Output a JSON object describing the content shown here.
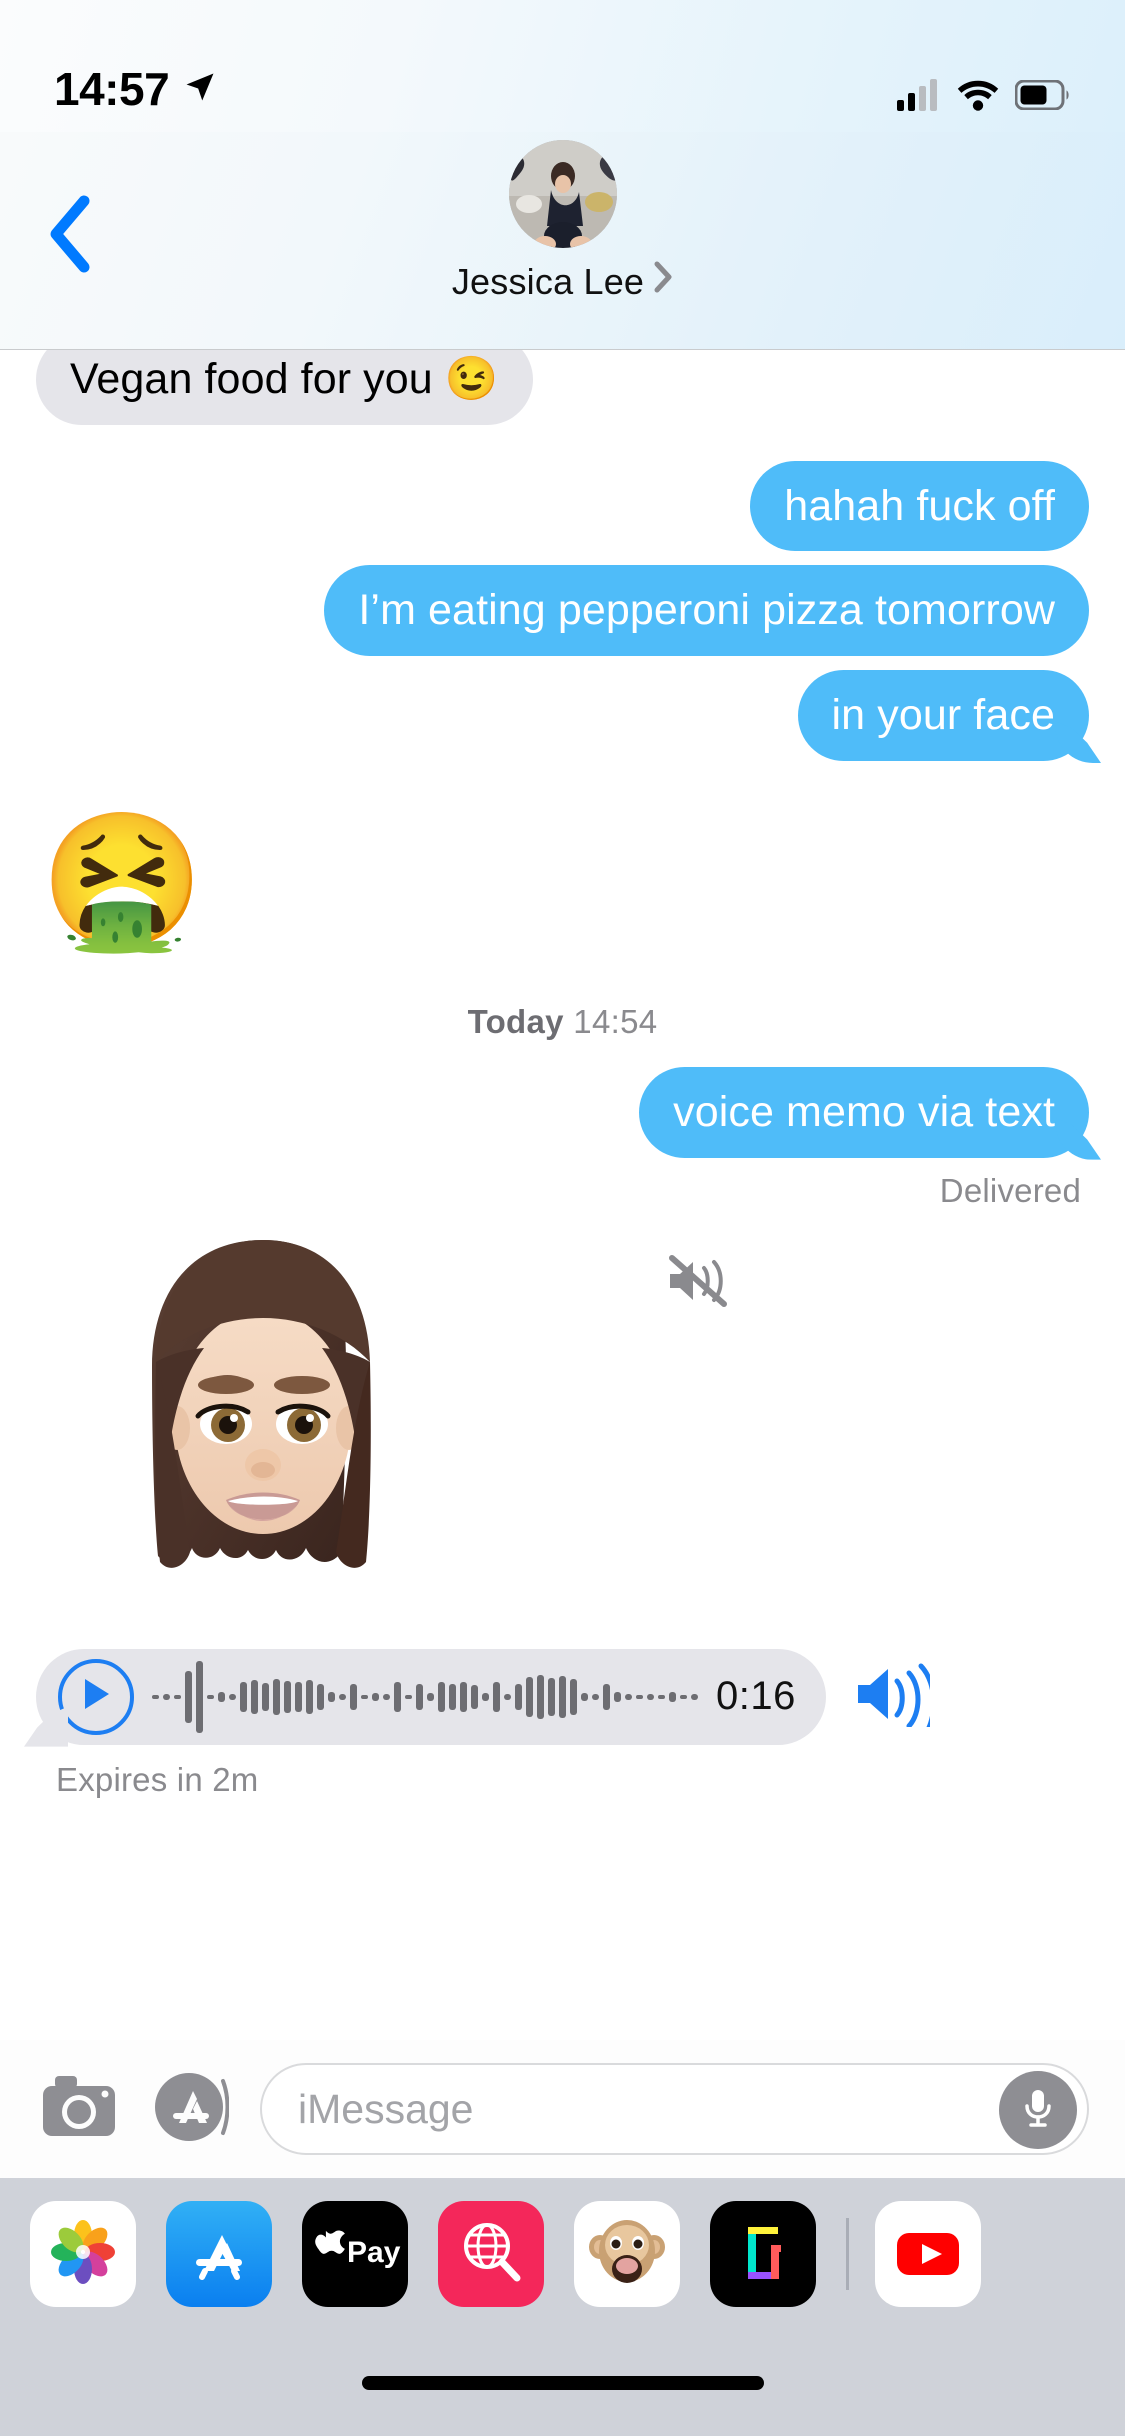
{
  "status_bar": {
    "time": "14:57",
    "location_icon": "location-arrow-icon",
    "cellular_icon": "cellular-bars-icon",
    "wifi_icon": "wifi-icon",
    "battery_icon": "battery-icon",
    "cellular_bars_filled": 2,
    "cellular_bars_total": 4,
    "battery_level_percent": 55
  },
  "nav_bar": {
    "back_icon": "chevron-left-icon",
    "contact_name": "Jessica Lee",
    "disclosure_icon": "chevron-right-icon",
    "avatar_name": "contact-avatar-photo"
  },
  "colors": {
    "bubble_sent": "#4FBCF9",
    "bubble_received": "#E5E5EA",
    "accent_blue": "#1D7EF2",
    "tint_blue": "#007AFF",
    "secondary_text": "#8A8A8E",
    "drawer_bg": "#CFD2D9"
  },
  "thread": {
    "messages": [
      {
        "id": "m1",
        "side": "received",
        "type": "text",
        "text": "Vegan food for you 😉",
        "tail": false
      },
      {
        "id": "m2",
        "side": "sent",
        "type": "text",
        "text": "hahah fuck off",
        "tail": false
      },
      {
        "id": "m3",
        "side": "sent",
        "type": "text",
        "text": "I’m eating pepperoni pizza tomorrow",
        "tail": false
      },
      {
        "id": "m4",
        "side": "sent",
        "type": "text",
        "text": "in your face",
        "tail": true
      },
      {
        "id": "m5",
        "side": "received",
        "type": "emoji",
        "text": "🤮"
      }
    ],
    "timestamp": {
      "day": "Today",
      "time": "14:54"
    },
    "voice_memo_message": {
      "side": "sent",
      "text": "voice memo via text",
      "tail": true
    },
    "delivery_status": "Delivered",
    "sticker": {
      "name": "memoji-sticker",
      "mute_icon": "speaker-muted-icon",
      "hair_color": "#4b342a",
      "skin_color": "#f3d5c0"
    },
    "audio_player": {
      "play_icon": "play-icon",
      "duration": "0:16",
      "speaker_icon": "speaker-loud-icon",
      "waveform_bars": [
        4,
        6,
        4,
        52,
        72,
        4,
        10,
        6,
        30,
        34,
        28,
        36,
        32,
        30,
        34,
        26,
        10,
        6,
        26,
        4,
        8,
        6,
        30,
        4,
        26,
        8,
        30,
        26,
        30,
        24,
        8,
        30,
        6,
        26,
        40,
        44,
        38,
        42,
        36,
        8,
        6,
        26,
        10,
        6,
        4,
        6,
        4,
        10,
        4,
        6
      ]
    },
    "expiry_label": "Expires in 2m"
  },
  "input_bar": {
    "camera_icon": "camera-icon",
    "apps_icon": "app-store-icon",
    "placeholder": "iMessage",
    "value": "",
    "mic_icon": "microphone-icon"
  },
  "app_drawer": {
    "apps": [
      {
        "id": "photos",
        "label": "Photos",
        "icon": "photos-icon"
      },
      {
        "id": "appstore",
        "label": "App Store",
        "icon": "app-store-icon"
      },
      {
        "id": "applepay",
        "label": "Apple Pay",
        "icon": "apple-pay-icon",
        "text": "Pay"
      },
      {
        "id": "images",
        "label": "#images",
        "icon": "images-search-icon"
      },
      {
        "id": "animoji",
        "label": "Animoji",
        "icon": "monkey-animoji-icon"
      },
      {
        "id": "giphy",
        "label": "GIPHY",
        "icon": "giphy-icon"
      },
      {
        "id": "youtube",
        "label": "YouTube",
        "icon": "youtube-icon"
      }
    ]
  },
  "home_bar": {
    "indicator": "home-indicator"
  }
}
